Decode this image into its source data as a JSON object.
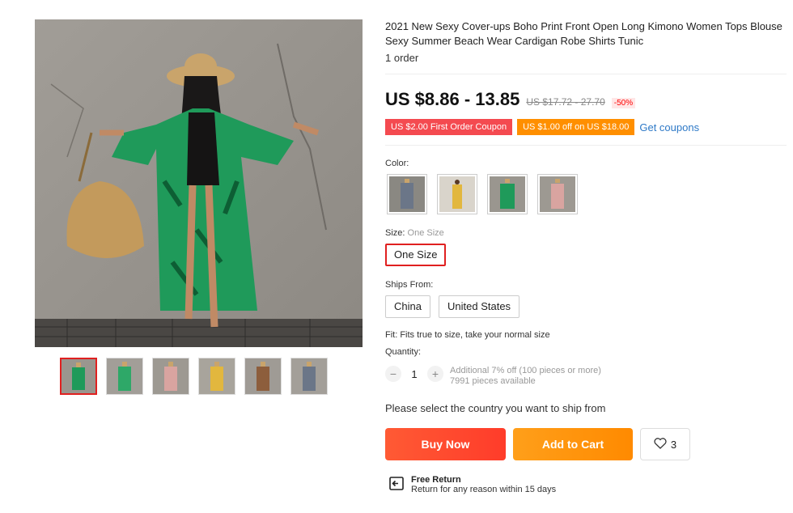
{
  "product": {
    "title": "2021 New Sexy Cover-ups Boho Print Front Open Long Kimono Women Tops Blouse Sexy Summer Beach Wear Cardigan Robe Shirts Tunic",
    "orders": "1 order",
    "price": "US $8.86 - 13.85",
    "original_price": "US $17.72 - 27.70",
    "discount": "-50%"
  },
  "coupons": {
    "first_order": "US $2.00 First Order Coupon",
    "store": "US $1.00 off on US $18.00",
    "get_coupons": "Get coupons"
  },
  "color": {
    "label": "Color:",
    "options": [
      "grey",
      "yellow",
      "green",
      "pink"
    ]
  },
  "size": {
    "label": "Size:",
    "value": "One Size",
    "option": "One Size"
  },
  "ships_from": {
    "label": "Ships From:",
    "options": [
      "China",
      "United States"
    ]
  },
  "fit": "Fit: Fits true to size, take your normal size",
  "quantity": {
    "label": "Quantity:",
    "minus": "−",
    "value": "1",
    "plus": "+",
    "discount_note": "Additional 7% off (100 pieces or more)",
    "available": "7991 pieces available"
  },
  "ship_message": "Please select the country you want to ship from",
  "actions": {
    "buy_now": "Buy Now",
    "add_to_cart": "Add to Cart",
    "wish_count": "3"
  },
  "return_policy": {
    "title": "Free Return",
    "subtitle": "Return for any reason within 15 days"
  },
  "colors": {
    "accent_red": "#e02020",
    "buy_button": "#ff4b2b",
    "cart_button": "#ff8f00",
    "coupon_red": "#f44a50",
    "link_blue": "#2e79c7",
    "kimono_green": "#1f9a5a"
  },
  "thumbnails": [
    "green-kimono",
    "green-kimono-2",
    "pink-kimono",
    "yellow-kimono",
    "brown-kimono",
    "grey-kimono"
  ]
}
